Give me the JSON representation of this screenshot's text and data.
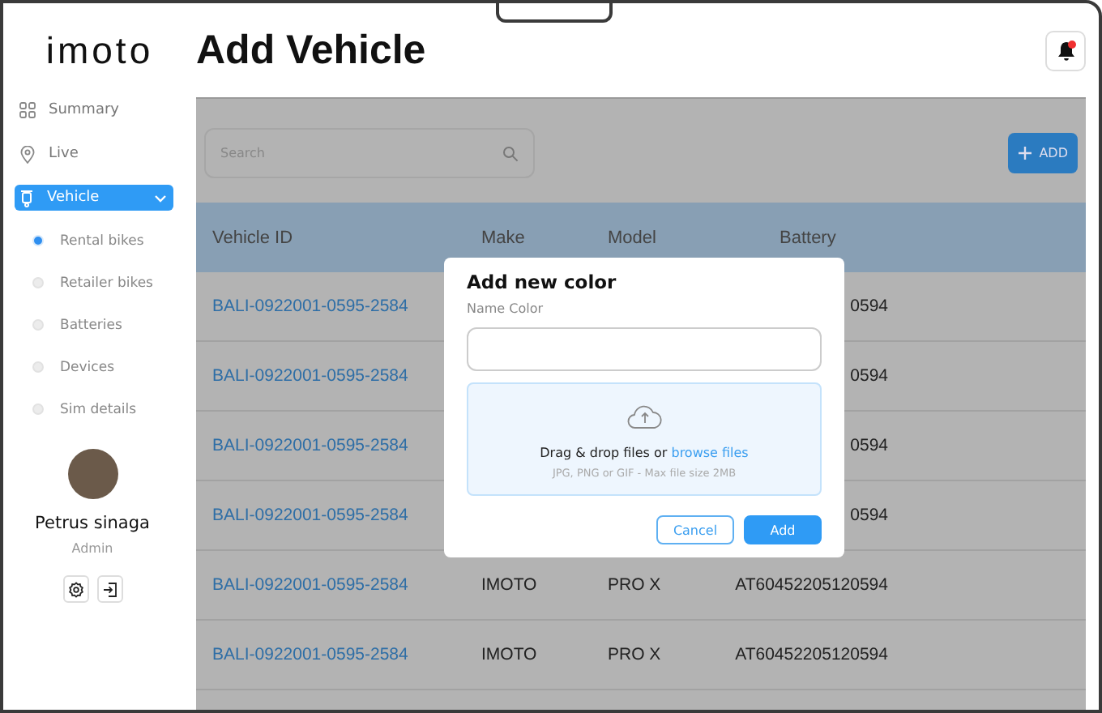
{
  "logo": "imoto",
  "page_title": "Add Vehicle",
  "notifications": {
    "unread": true
  },
  "sidebar": {
    "items": [
      {
        "label": "Summary",
        "selected": false
      },
      {
        "label": "Live",
        "selected": false
      },
      {
        "label": "Vehicle",
        "selected": true,
        "expanded": true,
        "children": [
          {
            "label": "Rental bikes",
            "selected": true
          },
          {
            "label": "Retailer bikes",
            "selected": false
          },
          {
            "label": "Batteries",
            "selected": false
          },
          {
            "label": "Devices",
            "selected": false
          },
          {
            "label": "Sim details",
            "selected": false
          }
        ]
      }
    ]
  },
  "user": {
    "name": "Petrus sinaga",
    "role": "Admin"
  },
  "search": {
    "placeholder": "Search"
  },
  "add_button": "ADD",
  "table": {
    "columns": [
      "Vehicle ID",
      "Make",
      "Model",
      "Battery"
    ],
    "rows": [
      {
        "vehicle_id": "BALI-0922001-0595-2584",
        "battery": "0594"
      },
      {
        "vehicle_id": "BALI-0922001-0595-2584",
        "battery": "0594"
      },
      {
        "vehicle_id": "BALI-0922001-0595-2584",
        "battery": "0594"
      },
      {
        "vehicle_id": "BALI-0922001-0595-2584",
        "battery": "0594"
      },
      {
        "vehicle_id": "BALI-0922001-0595-2584",
        "make": "IMOTO",
        "model": "PRO X",
        "battery": "AT60452205120594"
      },
      {
        "vehicle_id": "BALI-0922001-0595-2584",
        "make": "IMOTO",
        "model": "PRO X",
        "battery": "AT60452205120594"
      }
    ]
  },
  "dialog": {
    "title": "Add new color",
    "field_label": "Name Color",
    "dropzone_text": "Drag & drop files or",
    "dropzone_link": "browse files",
    "dropzone_hint": "JPG, PNG or GIF - Max file size 2MB",
    "buttons": [
      "Cancel",
      "Add"
    ]
  }
}
